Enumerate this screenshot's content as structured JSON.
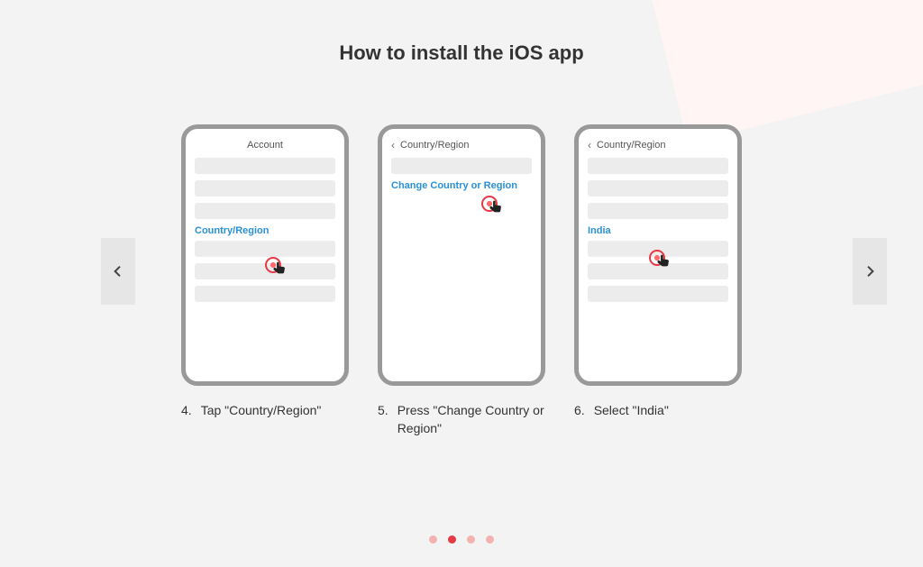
{
  "title": "How to install the iOS app",
  "slides": [
    {
      "number": "4.",
      "caption": "Tap \"Country/Region\"",
      "header": "Account",
      "header_back": false,
      "link_text": "Country/Region",
      "layout": "account"
    },
    {
      "number": "5.",
      "caption": "Press \"Change Country or Region\"",
      "header": "Country/Region",
      "header_back": true,
      "link_text": "Change Country or Region",
      "layout": "change"
    },
    {
      "number": "6.",
      "caption": "Select \"India\"",
      "header": "Country/Region",
      "header_back": true,
      "link_text": "India",
      "layout": "india"
    }
  ],
  "pagination": {
    "total": 4,
    "active_index": 1
  }
}
